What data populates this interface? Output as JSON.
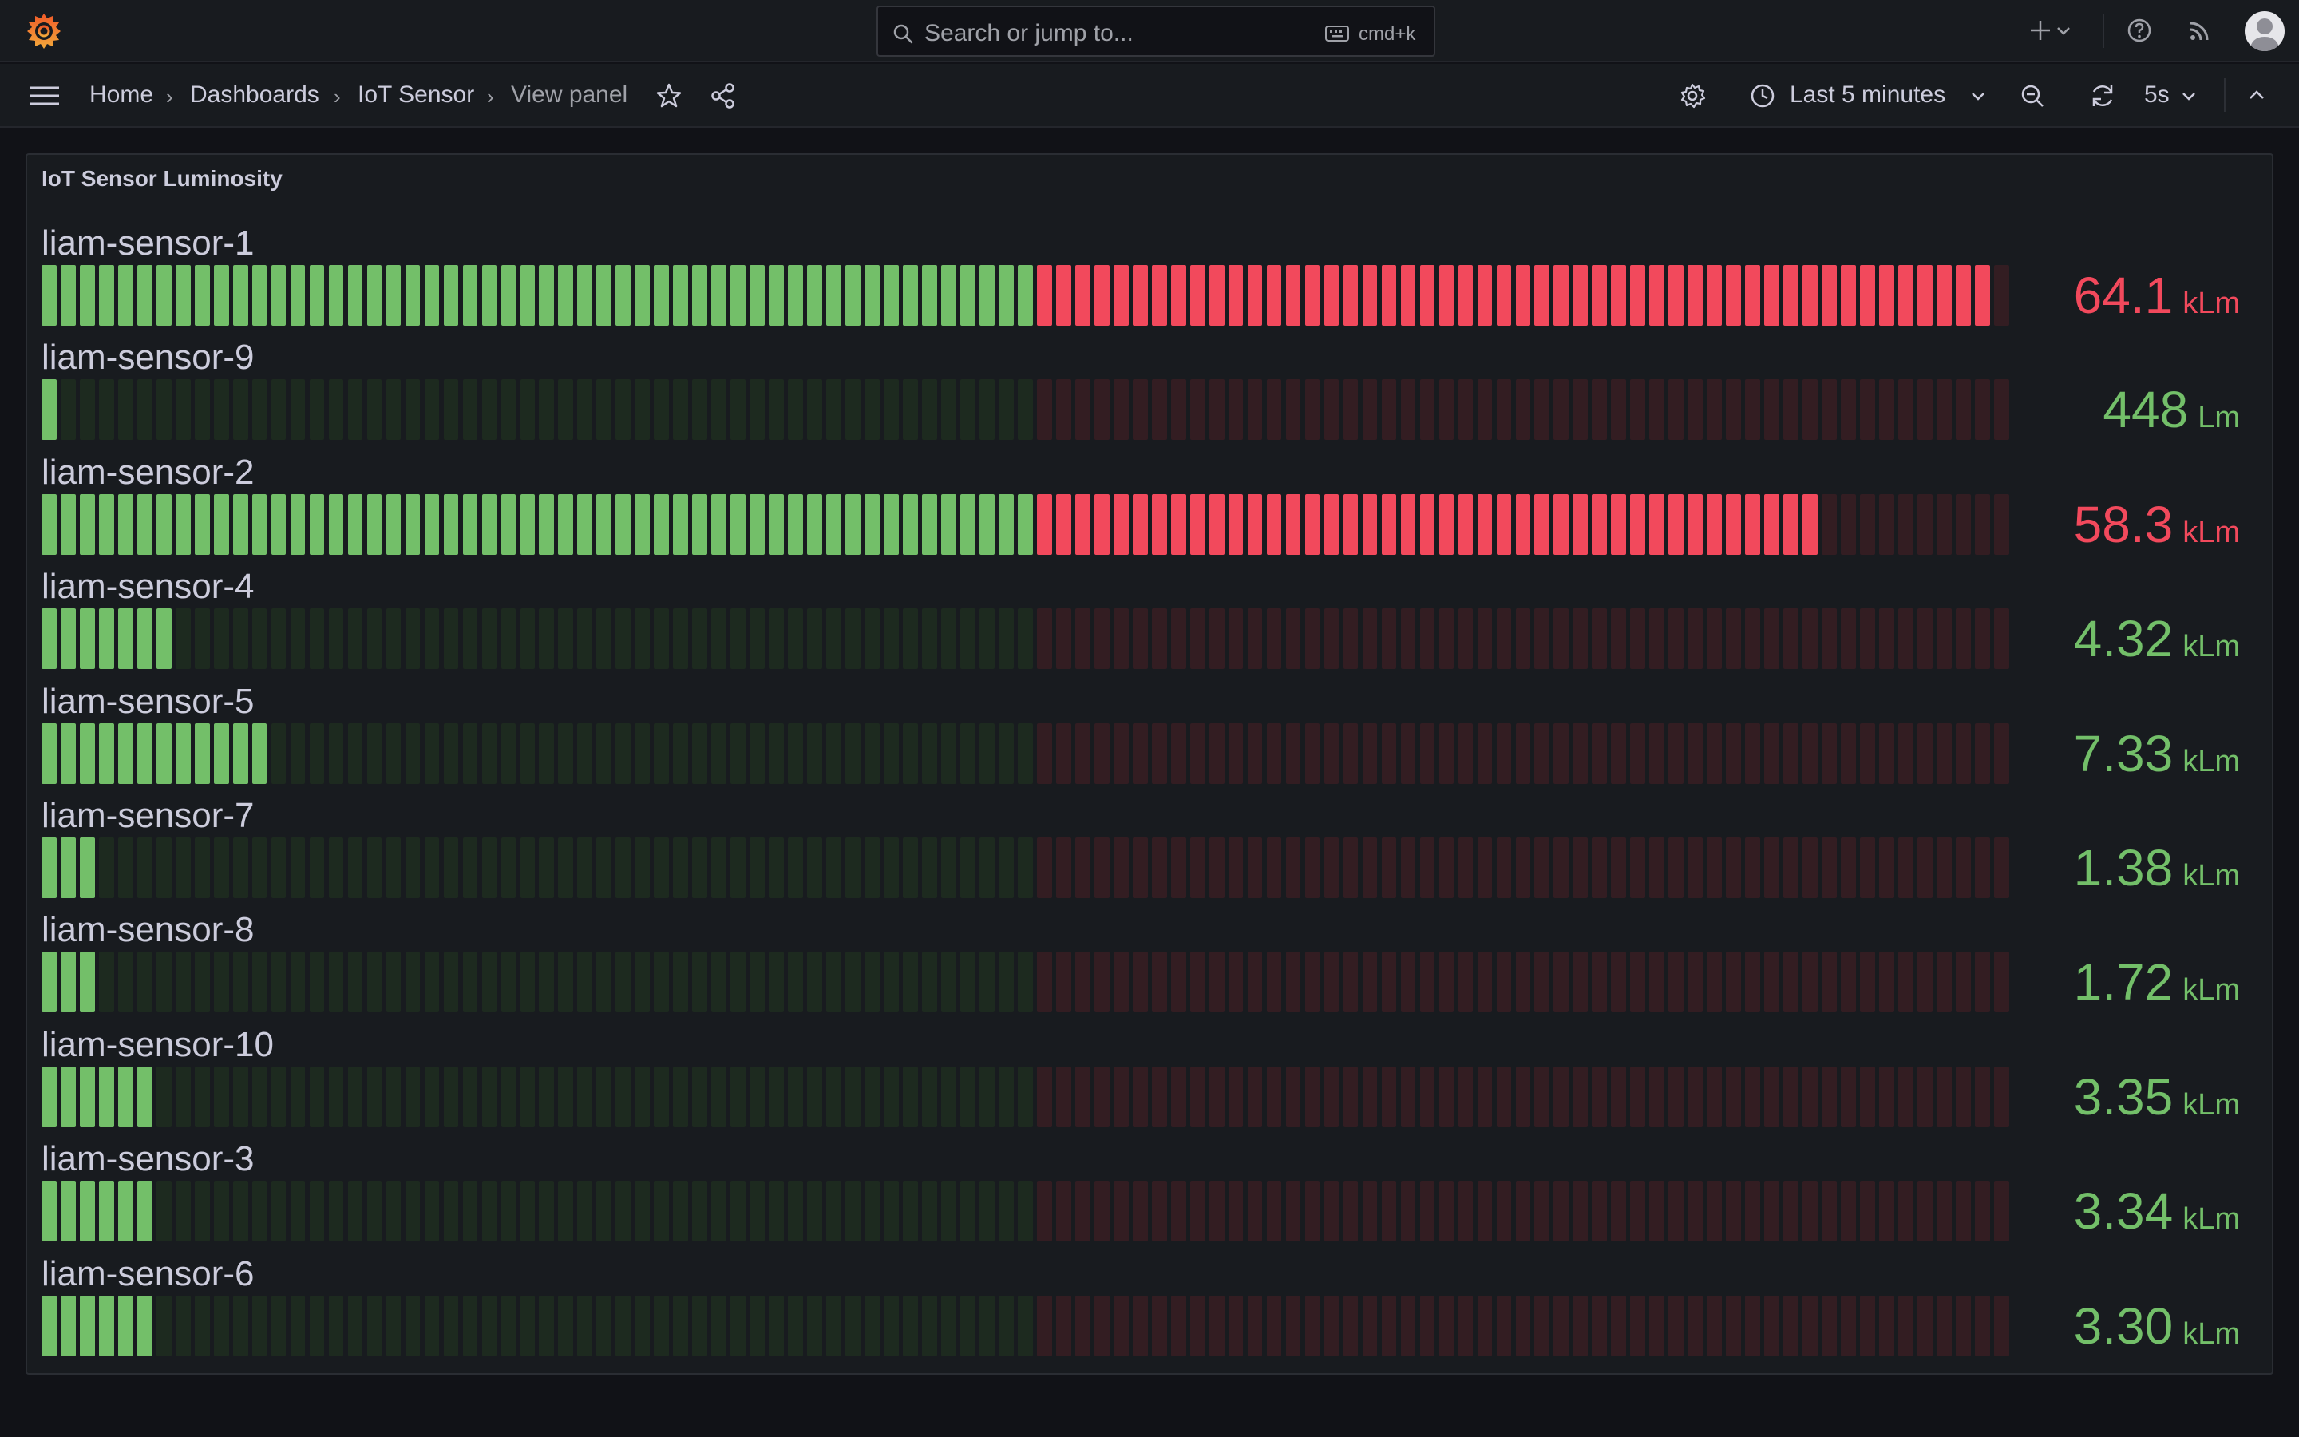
{
  "search": {
    "placeholder": "Search or jump to...",
    "shortcut": "cmd+k"
  },
  "breadcrumb": {
    "home": "Home",
    "dashboards": "Dashboards",
    "dashboard": "IoT Sensor",
    "current": "View panel"
  },
  "time_picker": {
    "label": "Last 5 minutes"
  },
  "refresh": {
    "interval": "5s"
  },
  "panel": {
    "title": "IoT Sensor Luminosity",
    "threshold_fraction": 0.5,
    "colors": {
      "green": "#73bf69",
      "green_dim": "#1d2a1f",
      "red": "#f2495c",
      "red_dim": "#331d22"
    },
    "sensors": [
      {
        "name": "liam-sensor-1",
        "value": "64.1",
        "unit": "kLm",
        "level": 0.991,
        "status": "red"
      },
      {
        "name": "liam-sensor-9",
        "value": "448",
        "unit": "Lm",
        "level": 0.007,
        "status": "green"
      },
      {
        "name": "liam-sensor-2",
        "value": "58.3",
        "unit": "kLm",
        "level": 0.901,
        "status": "red"
      },
      {
        "name": "liam-sensor-4",
        "value": "4.32",
        "unit": "kLm",
        "level": 0.067,
        "status": "green"
      },
      {
        "name": "liam-sensor-5",
        "value": "7.33",
        "unit": "kLm",
        "level": 0.113,
        "status": "green"
      },
      {
        "name": "liam-sensor-7",
        "value": "1.38",
        "unit": "kLm",
        "level": 0.027,
        "status": "green"
      },
      {
        "name": "liam-sensor-8",
        "value": "1.72",
        "unit": "kLm",
        "level": 0.027,
        "status": "green"
      },
      {
        "name": "liam-sensor-10",
        "value": "3.35",
        "unit": "kLm",
        "level": 0.057,
        "status": "green"
      },
      {
        "name": "liam-sensor-3",
        "value": "3.34",
        "unit": "kLm",
        "level": 0.057,
        "status": "green"
      },
      {
        "name": "liam-sensor-6",
        "value": "3.30",
        "unit": "kLm",
        "level": 0.057,
        "status": "green"
      }
    ]
  },
  "icons": {
    "logo": "grafana-logo-icon",
    "search": "search-icon",
    "keyboard": "keyboard-icon",
    "add": "plus-icon",
    "help": "help-icon",
    "news": "rss-icon",
    "menu": "hamburger-menu-icon",
    "star": "star-icon",
    "share": "share-icon",
    "settings": "gear-icon",
    "clock": "clock-icon",
    "zoom_out": "zoom-out-icon",
    "refresh": "refresh-icon",
    "collapse": "chevron-up-icon"
  }
}
